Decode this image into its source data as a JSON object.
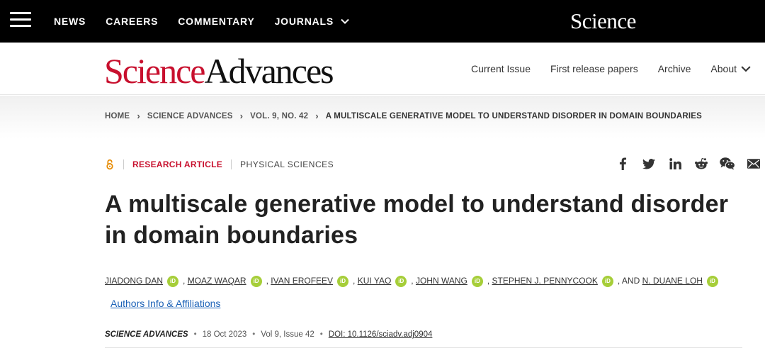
{
  "topnav": {
    "items": [
      "NEWS",
      "CAREERS",
      "COMMENTARY",
      "JOURNALS"
    ],
    "brand": "Science"
  },
  "header": {
    "logo_part1": "Science",
    "logo_part2": "Advances",
    "nav": [
      "Current Issue",
      "First release papers",
      "Archive",
      "About"
    ]
  },
  "breadcrumb": [
    "HOME",
    "SCIENCE ADVANCES",
    "VOL. 9, NO. 42",
    "A MULTISCALE GENERATIVE MODEL TO UNDERSTAND DISORDER IN DOMAIN BOUNDARIES"
  ],
  "article": {
    "type": "RESEARCH ARTICLE",
    "subject": "PHYSICAL SCIENCES",
    "title_line1": "A multiscale generative model to understand disorder",
    "title_line2": "in domain boundaries",
    "authors": [
      "JIADONG DAN",
      "MOAZ WAQAR",
      "IVAN EROFEEV",
      "KUI YAO",
      "JOHN WANG",
      "STEPHEN J. PENNYCOOK",
      "N. DUANE LOH"
    ],
    "and_text": ", AND",
    "affiliations_link": "Authors Info & Affiliations",
    "orcid_label": "iD",
    "journal": "SCIENCE ADVANCES",
    "date": "18 Oct 2023",
    "volume": "Vol 9, Issue 42",
    "doi": "DOI: 10.1126/sciadv.adj0904"
  },
  "share_icons": [
    "facebook-icon",
    "twitter-icon",
    "linkedin-icon",
    "reddit-icon",
    "wechat-icon",
    "email-icon"
  ],
  "colors": {
    "brand_red": "#c8102e",
    "orcid_green": "#a6ce39",
    "link_blue": "#1d63b8",
    "open_access_orange": "#e68a00"
  }
}
